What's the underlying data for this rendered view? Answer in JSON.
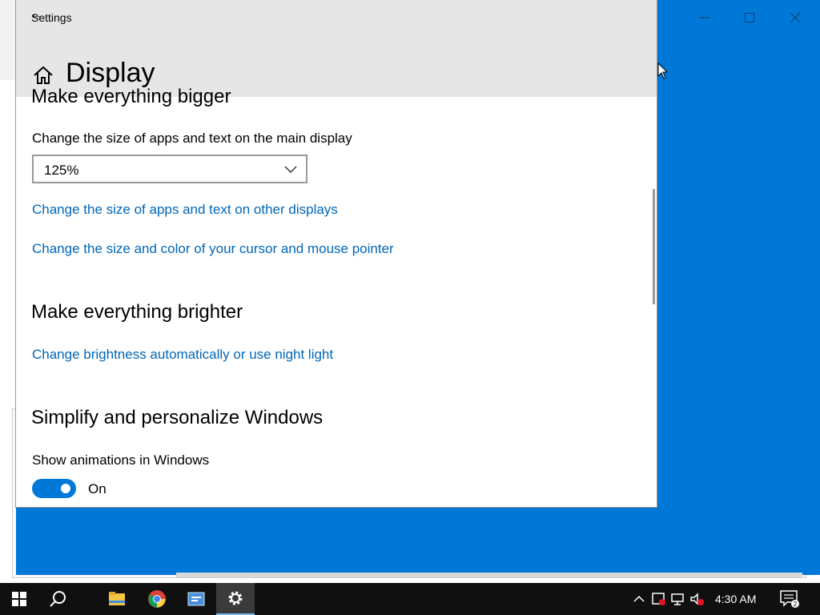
{
  "window": {
    "title": "Settings",
    "back_glyph": "←"
  },
  "header": {
    "title": "Display"
  },
  "content": {
    "partial_heading": "Make everything bigger",
    "scale_label": "Change the size of apps and text on the main display",
    "scale_value": "125%",
    "link_other_displays": "Change the size of apps and text on other displays",
    "link_cursor": "Change the size and color of your cursor and mouse pointer",
    "brighter_heading": "Make everything brighter",
    "link_brightness": "Change brightness automatically or use night light",
    "simplify_heading": "Simplify and personalize Windows",
    "animations_label": "Show animations in Windows",
    "animations_state": "On"
  },
  "taskbar": {
    "clock": "4:30 AM",
    "notification_count": "2"
  },
  "colors": {
    "accent": "#0078d7",
    "link": "#0067b8",
    "taskbar": "#101010"
  }
}
